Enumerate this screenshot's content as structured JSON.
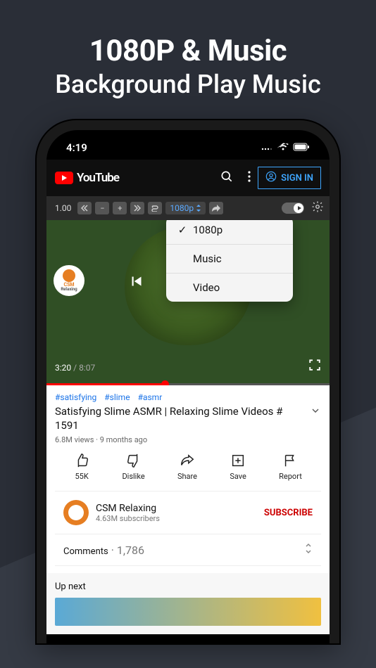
{
  "promo": {
    "line1": "1080P & Music",
    "line2": "Background Play Music"
  },
  "status": {
    "time": "4:19"
  },
  "header": {
    "brand": "YouTube",
    "signin": "SIGN IN"
  },
  "toolbar": {
    "speed": "1.00",
    "quality_label": "1080p"
  },
  "popover": {
    "items": [
      {
        "label": "1080p",
        "checked": true
      },
      {
        "label": "Music",
        "checked": false
      },
      {
        "label": "Video",
        "checked": false
      }
    ]
  },
  "video": {
    "current": "3:20",
    "duration": "8:07",
    "badge_top": "CSM",
    "badge_bottom": "Relaxing"
  },
  "meta": {
    "hashtags": [
      "#satisfying",
      "#slime",
      "#asmr"
    ],
    "title": "Satisfying Slime ASMR | Relaxing Slime Videos # 1591",
    "views": "6.8M views",
    "sep": "·",
    "age": "9 months ago"
  },
  "actions": {
    "like": "55K",
    "dislike": "Dislike",
    "share": "Share",
    "save": "Save",
    "report": "Report"
  },
  "channel": {
    "name": "CSM Relaxing",
    "subs": "4.63M subscribers",
    "cta": "SUBSCRIBE"
  },
  "comments": {
    "label": "Comments",
    "sep": "·",
    "count": "1,786"
  },
  "upnext": {
    "label": "Up next"
  }
}
